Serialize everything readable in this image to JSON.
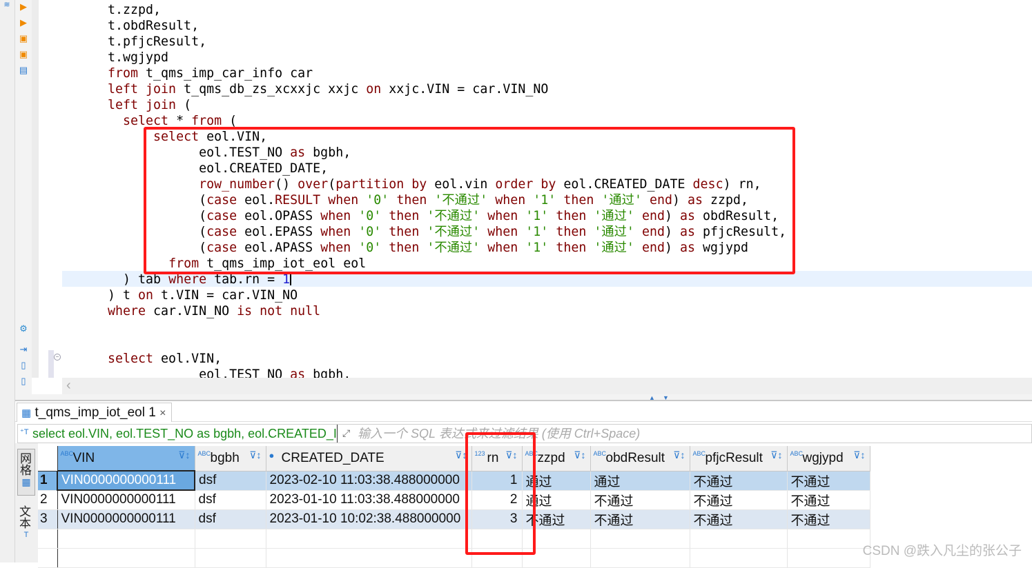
{
  "editor": {
    "lines": [
      {
        "indent": 0,
        "tokens": [
          [
            "t.zzpd,",
            ""
          ]
        ]
      },
      {
        "indent": 0,
        "tokens": [
          [
            "t.obdResult,",
            ""
          ]
        ]
      },
      {
        "indent": 0,
        "tokens": [
          [
            "t.pfjcResult,",
            ""
          ]
        ]
      },
      {
        "indent": 0,
        "tokens": [
          [
            "t.wgjypd",
            ""
          ]
        ]
      },
      {
        "indent": 0,
        "tokens": [
          [
            "from",
            "kw"
          ],
          [
            " t_qms_imp_car_info car",
            ""
          ]
        ]
      },
      {
        "indent": 0,
        "tokens": [
          [
            "left join",
            "kw"
          ],
          [
            " t_qms_db_zs_xcxxjc xxjc ",
            ""
          ],
          [
            "on",
            "kw"
          ],
          [
            " xxjc.VIN = car.VIN_NO",
            ""
          ]
        ]
      },
      {
        "indent": 0,
        "tokens": [
          [
            "left join",
            "kw"
          ],
          [
            " (",
            ""
          ]
        ]
      },
      {
        "indent": 2,
        "tokens": [
          [
            "select",
            "kw"
          ],
          [
            " * ",
            ""
          ],
          [
            "from",
            "kw"
          ],
          [
            " (",
            ""
          ]
        ]
      },
      {
        "indent": 6,
        "tokens": [
          [
            "select",
            "kw"
          ],
          [
            " eol.VIN,",
            ""
          ]
        ]
      },
      {
        "indent": 12,
        "tokens": [
          [
            "eol.TEST_NO ",
            ""
          ],
          [
            "as",
            "kw"
          ],
          [
            " bgbh,",
            ""
          ]
        ]
      },
      {
        "indent": 12,
        "tokens": [
          [
            "eol.CREATED_DATE,",
            ""
          ]
        ]
      },
      {
        "indent": 12,
        "tokens": [
          [
            "row_number",
            "kw"
          ],
          [
            "() ",
            ""
          ],
          [
            "over",
            "kw"
          ],
          [
            "(",
            ""
          ],
          [
            "partition by",
            "kw"
          ],
          [
            " eol.vin ",
            ""
          ],
          [
            "order by",
            "kw"
          ],
          [
            " eol.CREATED_DATE ",
            ""
          ],
          [
            "desc",
            "kw"
          ],
          [
            ") rn,",
            ""
          ]
        ]
      },
      {
        "indent": 12,
        "tokens": [
          [
            "(",
            ""
          ],
          [
            "case",
            "kw"
          ],
          [
            " eol.",
            ""
          ],
          [
            "RESULT",
            "kw"
          ],
          [
            " ",
            ""
          ],
          [
            "when",
            "kw"
          ],
          [
            " ",
            ""
          ],
          [
            "'0'",
            "str"
          ],
          [
            " ",
            ""
          ],
          [
            "then",
            "kw"
          ],
          [
            " ",
            ""
          ],
          [
            "'不通过'",
            "str"
          ],
          [
            " ",
            ""
          ],
          [
            "when",
            "kw"
          ],
          [
            " ",
            ""
          ],
          [
            "'1'",
            "str"
          ],
          [
            " ",
            ""
          ],
          [
            "then",
            "kw"
          ],
          [
            " ",
            ""
          ],
          [
            "'通过'",
            "str"
          ],
          [
            " ",
            ""
          ],
          [
            "end",
            "kw"
          ],
          [
            ") ",
            ""
          ],
          [
            "as",
            "kw"
          ],
          [
            " zzpd,",
            ""
          ]
        ]
      },
      {
        "indent": 12,
        "tokens": [
          [
            "(",
            ""
          ],
          [
            "case",
            "kw"
          ],
          [
            " eol.OPASS ",
            ""
          ],
          [
            "when",
            "kw"
          ],
          [
            " ",
            ""
          ],
          [
            "'0'",
            "str"
          ],
          [
            " ",
            ""
          ],
          [
            "then",
            "kw"
          ],
          [
            " ",
            ""
          ],
          [
            "'不通过'",
            "str"
          ],
          [
            " ",
            ""
          ],
          [
            "when",
            "kw"
          ],
          [
            " ",
            ""
          ],
          [
            "'1'",
            "str"
          ],
          [
            " ",
            ""
          ],
          [
            "then",
            "kw"
          ],
          [
            " ",
            ""
          ],
          [
            "'通过'",
            "str"
          ],
          [
            " ",
            ""
          ],
          [
            "end",
            "kw"
          ],
          [
            ") ",
            ""
          ],
          [
            "as",
            "kw"
          ],
          [
            " obdResult,",
            ""
          ]
        ]
      },
      {
        "indent": 12,
        "tokens": [
          [
            "(",
            ""
          ],
          [
            "case",
            "kw"
          ],
          [
            " eol.EPASS ",
            ""
          ],
          [
            "when",
            "kw"
          ],
          [
            " ",
            ""
          ],
          [
            "'0'",
            "str"
          ],
          [
            " ",
            ""
          ],
          [
            "then",
            "kw"
          ],
          [
            " ",
            ""
          ],
          [
            "'不通过'",
            "str"
          ],
          [
            " ",
            ""
          ],
          [
            "when",
            "kw"
          ],
          [
            " ",
            ""
          ],
          [
            "'1'",
            "str"
          ],
          [
            " ",
            ""
          ],
          [
            "then",
            "kw"
          ],
          [
            " ",
            ""
          ],
          [
            "'通过'",
            "str"
          ],
          [
            " ",
            ""
          ],
          [
            "end",
            "kw"
          ],
          [
            ") ",
            ""
          ],
          [
            "as",
            "kw"
          ],
          [
            " pfjcResult,",
            ""
          ]
        ]
      },
      {
        "indent": 12,
        "tokens": [
          [
            "(",
            ""
          ],
          [
            "case",
            "kw"
          ],
          [
            " eol.APASS ",
            ""
          ],
          [
            "when",
            "kw"
          ],
          [
            " ",
            ""
          ],
          [
            "'0'",
            "str"
          ],
          [
            " ",
            ""
          ],
          [
            "then",
            "kw"
          ],
          [
            " ",
            ""
          ],
          [
            "'不通过'",
            "str"
          ],
          [
            " ",
            ""
          ],
          [
            "when",
            "kw"
          ],
          [
            " ",
            ""
          ],
          [
            "'1'",
            "str"
          ],
          [
            " ",
            ""
          ],
          [
            "then",
            "kw"
          ],
          [
            " ",
            ""
          ],
          [
            "'通过'",
            "str"
          ],
          [
            " ",
            ""
          ],
          [
            "end",
            "kw"
          ],
          [
            ") ",
            ""
          ],
          [
            "as",
            "kw"
          ],
          [
            " wgjypd",
            ""
          ]
        ]
      },
      {
        "indent": 8,
        "tokens": [
          [
            "from",
            "kw"
          ],
          [
            " t_qms_imp_iot_eol eol",
            ""
          ]
        ]
      },
      {
        "indent": 2,
        "tokens": [
          [
            ") tab ",
            ""
          ],
          [
            "where",
            "kw"
          ],
          [
            " tab.rn = ",
            ""
          ],
          [
            "1",
            "num"
          ]
        ],
        "caret": true
      },
      {
        "indent": 0,
        "tokens": [
          [
            ") t ",
            ""
          ],
          [
            "on",
            "kw"
          ],
          [
            " t.VIN = car.VIN_NO",
            ""
          ]
        ]
      },
      {
        "indent": 0,
        "tokens": [
          [
            "where",
            "kw"
          ],
          [
            " car.VIN_NO ",
            ""
          ],
          [
            "is not null",
            "kw"
          ]
        ]
      },
      {
        "indent": 0,
        "tokens": []
      },
      {
        "indent": 0,
        "tokens": []
      },
      {
        "indent": 0,
        "tokens": [
          [
            "select",
            "kw"
          ],
          [
            " eol.VIN,",
            ""
          ]
        ]
      },
      {
        "indent": 12,
        "tokens": [
          [
            "eol.TEST_NO ",
            ""
          ],
          [
            "as",
            "kw"
          ],
          [
            " bgbh,",
            ""
          ]
        ]
      }
    ]
  },
  "results": {
    "tab_label": "t_qms_imp_iot_eol 1",
    "close_glyph": "×",
    "query_text": "select eol.VIN, eol.TEST_NO as bgbh, eol.CREATED_I",
    "filter_placeholder": "输入一个 SQL 表达式来过滤结果 (使用 Ctrl+Space)",
    "view_grid": "网格",
    "view_text": "文本",
    "columns": [
      {
        "name": "VIN",
        "type": "ABC"
      },
      {
        "name": "bgbh",
        "type": "ABC"
      },
      {
        "name": "CREATED_DATE",
        "type": "clock"
      },
      {
        "name": "rn",
        "type": "123"
      },
      {
        "name": "zzpd",
        "type": "ABC"
      },
      {
        "name": "obdResult",
        "type": "ABC"
      },
      {
        "name": "pfjcResult",
        "type": "ABC"
      },
      {
        "name": "wgjypd",
        "type": "ABC"
      }
    ],
    "rows": [
      [
        "1",
        "VIN0000000000111",
        "dsf",
        "2023-02-10 11:03:38.488000000",
        "1",
        "通过",
        "通过",
        "不通过",
        "不通过"
      ],
      [
        "2",
        "VIN0000000000111",
        "dsf",
        "2023-01-10 11:03:38.488000000",
        "2",
        "通过",
        "不通过",
        "不通过",
        "不通过"
      ],
      [
        "3",
        "VIN0000000000111",
        "dsf",
        "2023-01-10 10:02:38.488000000",
        "3",
        "不通过",
        "不通过",
        "不通过",
        "不通过"
      ]
    ]
  },
  "watermark": "CSDN @跌入凡尘的张公子",
  "colors": {
    "keyword": "#7f0000",
    "string": "#2a8a00",
    "number": "#2020d0",
    "annotation": "#ff1a1a",
    "selection": "#7fb6e8"
  }
}
